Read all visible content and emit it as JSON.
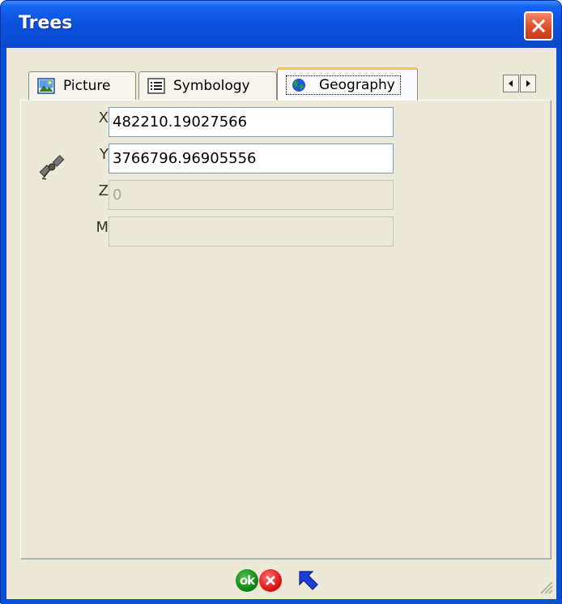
{
  "window": {
    "title": "Trees"
  },
  "tabs": [
    {
      "label": "Picture",
      "icon": "picture-icon"
    },
    {
      "label": "Symbology",
      "icon": "list-icon"
    },
    {
      "label": "Geography",
      "icon": "globe-icon",
      "active": true
    }
  ],
  "geography": {
    "icon": "satellite-icon",
    "fields": [
      {
        "label": "X",
        "value": "482210.19027566",
        "enabled": true
      },
      {
        "label": "Y",
        "value": "3766796.96905556",
        "enabled": true
      },
      {
        "label": "Z",
        "value": "0",
        "enabled": false
      },
      {
        "label": "M",
        "value": "",
        "enabled": false
      }
    ]
  },
  "footer": {
    "ok_label": "ok",
    "cancel_icon": "cancel-icon",
    "pointer_icon": "pointer-arrow-icon"
  },
  "colors": {
    "titlebar": "#0a4fd8",
    "close": "#e2502c",
    "client_bg": "#ece9d8",
    "ok_green": "#128a12",
    "cancel_red": "#e01818"
  }
}
